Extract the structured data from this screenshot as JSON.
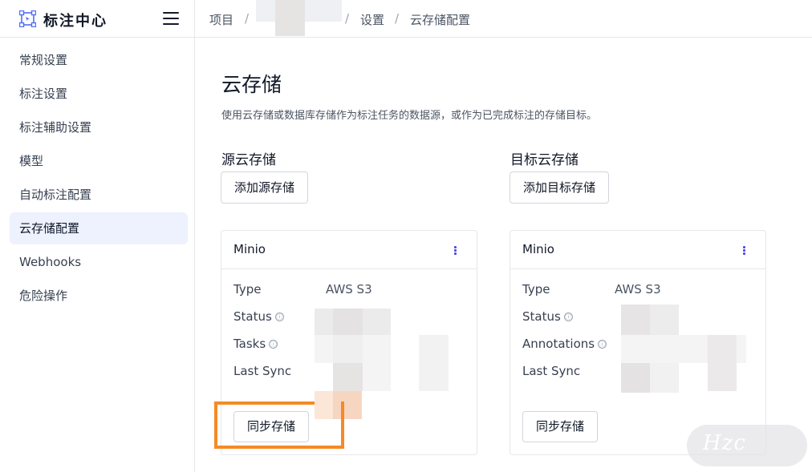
{
  "sidebar": {
    "brand_title": "标注中心",
    "items": [
      {
        "label": "常规设置"
      },
      {
        "label": "标注设置"
      },
      {
        "label": "标注辅助设置"
      },
      {
        "label": "模型"
      },
      {
        "label": "自动标注配置"
      },
      {
        "label": "云存储配置",
        "active": true
      },
      {
        "label": "Webhooks"
      },
      {
        "label": "危险操作"
      }
    ]
  },
  "breadcrumb": {
    "items": [
      "项目",
      "设置",
      "云存储配置"
    ],
    "separator": "/"
  },
  "main": {
    "title": "云存储",
    "description": "使用云存储或数据库存储作为标注任务的数据源，或作为已完成标注的存储目标。",
    "source": {
      "title": "源云存储",
      "add_button": "添加源存储",
      "card": {
        "name": "Minio",
        "rows": {
          "type_label": "Type",
          "type_value": "AWS S3",
          "status_label": "Status",
          "tasks_label": "Tasks",
          "last_sync_label": "Last Sync"
        },
        "sync_button": "同步存储"
      }
    },
    "target": {
      "title": "目标云存储",
      "add_button": "添加目标存储",
      "card": {
        "name": "Minio",
        "rows": {
          "type_label": "Type",
          "type_value": "AWS S3",
          "status_label": "Status",
          "annotations_label": "Annotations",
          "last_sync_label": "Last Sync"
        },
        "sync_button": "同步存储"
      }
    }
  },
  "icons": {
    "info": "ⓘ"
  },
  "colors": {
    "accent": "#4f46e5",
    "active_nav_bg": "#eef2ff",
    "highlight": "#f58a25"
  },
  "watermark": "Hzc"
}
